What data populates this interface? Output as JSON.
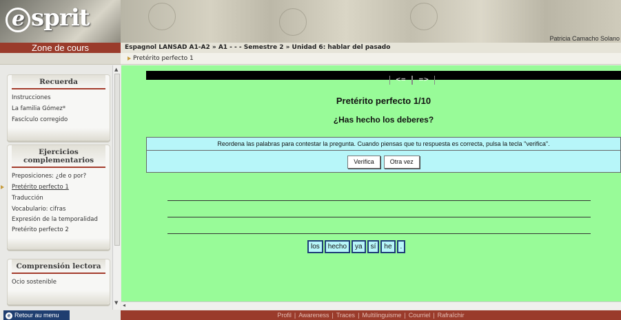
{
  "logo": {
    "text": "sprit",
    "letter": "e"
  },
  "user": {
    "name": "Patricia Camacho Solano"
  },
  "zone_label": "Zone de cours",
  "breadcrumb": "Espagnol LANSAD A1-A2 » A1 - - - Semestre 2 » Unidad 6: hablar del pasado",
  "sub_breadcrumb": "Pretérito perfecto 1",
  "sidebar": {
    "recuerda": {
      "title": "Recuerda",
      "items": [
        "Instrucciones",
        "La familia Gómez*",
        "Fascículo corregido"
      ]
    },
    "ejercicios": {
      "title": "Ejercicios complementarios",
      "items": [
        "Preposiciones: ¿de o por?",
        "Pretérito perfecto 1",
        "Traducción",
        "Vocabulario: cifras",
        "Expresión de la temporalidad",
        "Pretérito perfecto 2"
      ]
    },
    "comprension": {
      "title": "Comprensión lectora",
      "items": [
        "Ocio sostenible"
      ]
    }
  },
  "retour": "Retour au menu",
  "exercise": {
    "prev": "<=",
    "next": "=>",
    "title": "Pretérito perfecto 1/10",
    "question": "¿Has hecho los deberes?",
    "instructions": "Reordena las palabras para contestar la pregunta. Cuando piensas que tu respuesta es correcta, pulsa la tecla \"verifica\".",
    "verify_label": "Verifica",
    "again_label": "Otra vez",
    "words": [
      "los",
      "hecho",
      "ya",
      "sí",
      "he",
      "."
    ]
  },
  "footer": [
    "Profil",
    "Awareness",
    "Traces",
    "Multilinguisme",
    "Courriel",
    "Rafraîchir"
  ],
  "colors": {
    "accent": "#9a3b2b",
    "exercise_bg": "#98fb98",
    "box_bg": "#b7f6f9",
    "word_border": "#1e3c78"
  }
}
